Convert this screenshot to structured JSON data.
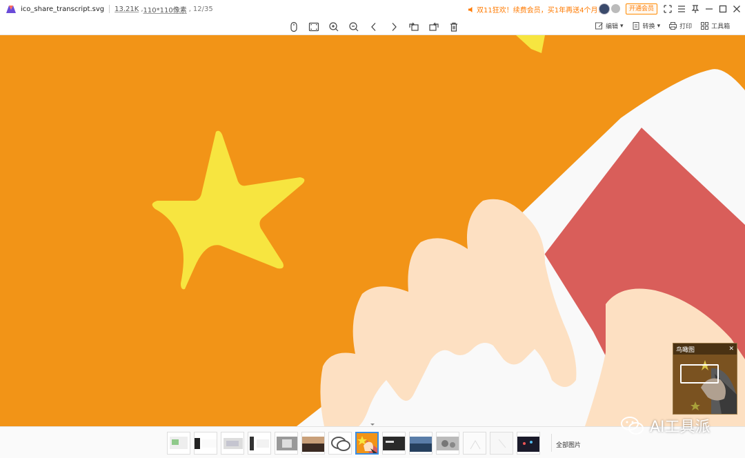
{
  "titlebar": {
    "filename": "ico_share_transcript.svg",
    "file_size": "13.21K",
    "dimensions": "110*110像素",
    "index": "12/35",
    "promo": "双11狂欢！续费会员，买1年再送4个月！",
    "vip_button": "开通会员"
  },
  "toolbar": {
    "edit": "编辑",
    "convert": "转换",
    "print": "打印",
    "tools": "工具箱"
  },
  "birdseye": {
    "title": "鸟瞰图"
  },
  "filmstrip": {
    "all_images": "全部图片",
    "thumbnail_count": 14,
    "active_index": 7
  },
  "watermark": {
    "text": "AI工具派"
  },
  "colors": {
    "canvas_bg": "#f29417",
    "star": "#f7e540",
    "sleeve_red": "#d95e5a",
    "hand": "#fde0c2",
    "cuff": "#f9f9f9",
    "promo": "#ff7a00",
    "active_thumb_border": "#3a8ee6"
  }
}
